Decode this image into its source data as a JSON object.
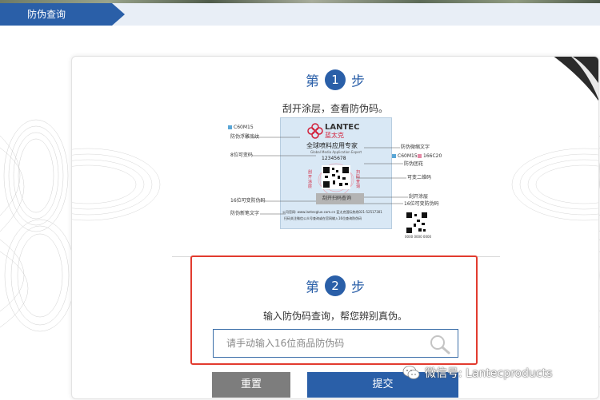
{
  "header": {
    "tab_label": "防伪查询"
  },
  "step1": {
    "prefix": "第",
    "number": "1",
    "suffix": "步",
    "description": "刮开涂层，查看防伪码。"
  },
  "label": {
    "brand": "LANTEC",
    "brand_cn": "蓝太克",
    "tagline": "全球喷料应用专家",
    "tagline_en": "Global Media Application Expert",
    "serial": "12345678",
    "scratch_text": "刮开扫码查询",
    "left_stamp": "刮开涂层",
    "right_stamp": "扫码查询",
    "footer_line1": "公司官网: www.lantecglue.com.cn  蓝太克国际热线021-52517301",
    "footer_line2": "扫码关注微信公众号查询或在官网输入16位查询防伪码",
    "callouts_left": [
      "C60M15",
      "防伪浮雕底纹",
      "8位可变码",
      "16位可变防伪码",
      "防伪新笔文字"
    ],
    "callouts_right": [
      "防伪微缩文字",
      "C60M15",
      "166C20",
      "防伪团花",
      "可变二维码",
      "刮开涂层",
      "16位可变防伪码"
    ],
    "qr_caption": "0000 0000 0000"
  },
  "step2": {
    "prefix": "第",
    "number": "2",
    "suffix": "步",
    "description": "输入防伪码查询，帮您辨别真伪。"
  },
  "search": {
    "placeholder": "请手动输入16位商品防伪码",
    "value": ""
  },
  "buttons": {
    "reset": "重置",
    "submit": "提交"
  },
  "watermark": {
    "text": "微信号: Lantecproducts"
  },
  "colors": {
    "primary": "#2a5fa8",
    "highlight_border": "#e23b2f",
    "reset_button": "#7d7d7d"
  }
}
